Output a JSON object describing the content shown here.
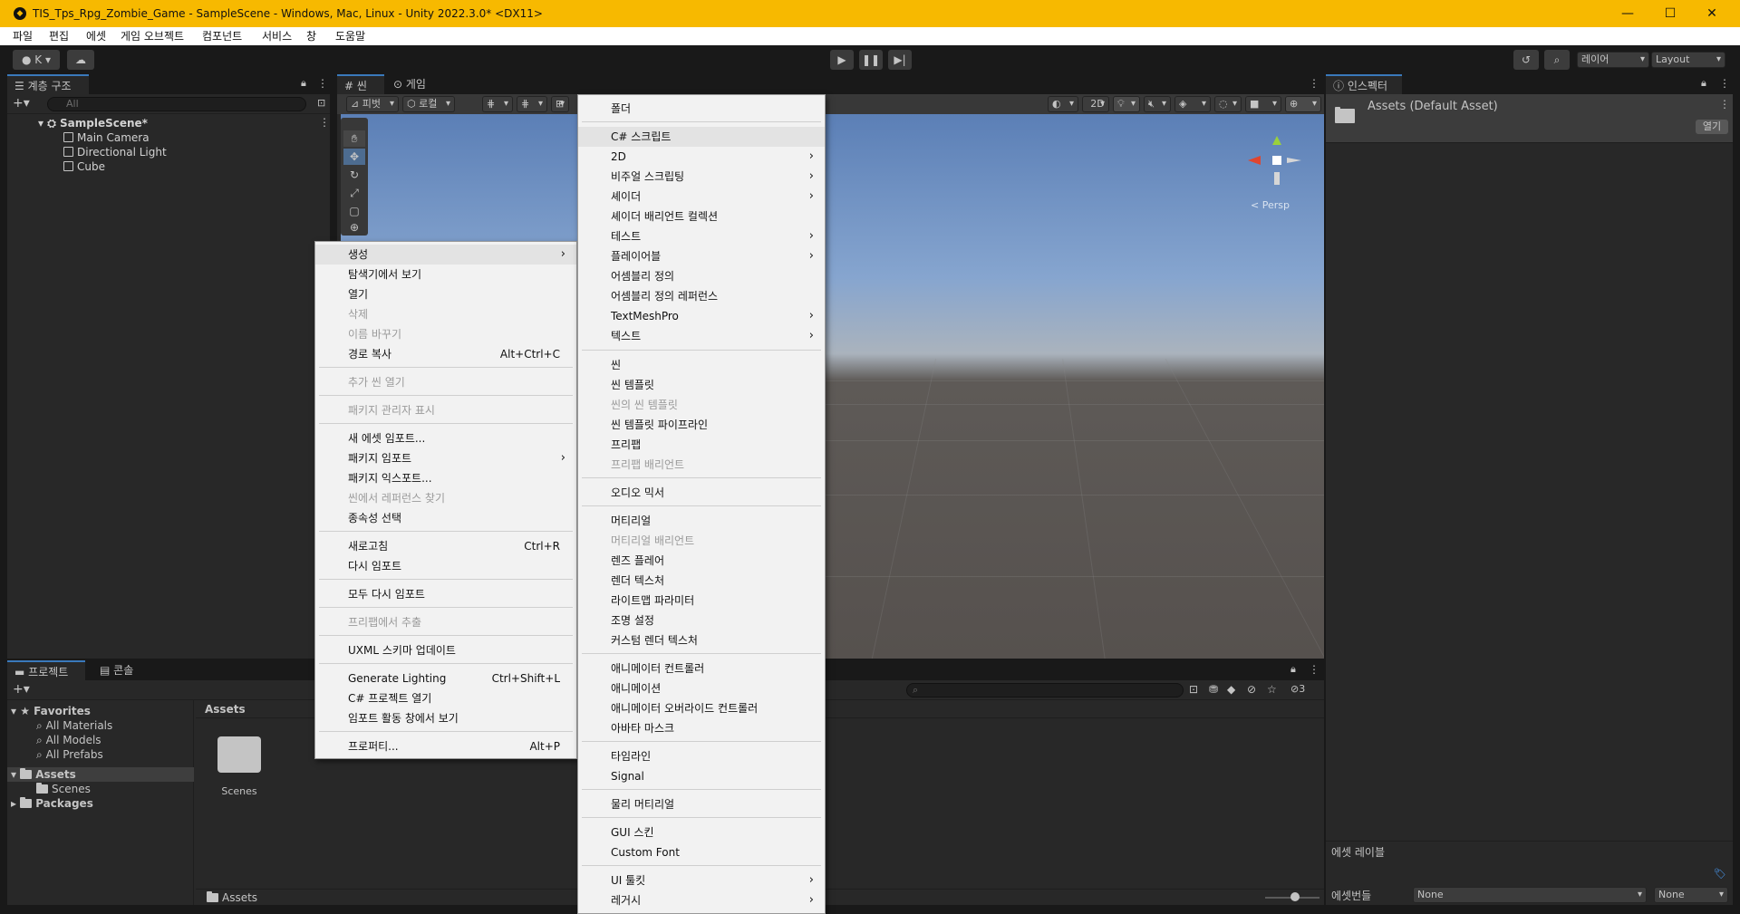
{
  "window": {
    "title": "TIS_Tps_Rpg_Zombie_Game - SampleScene - Windows, Mac, Linux - Unity 2022.3.0* <DX11>",
    "controls": [
      "—",
      "☐",
      "✕"
    ]
  },
  "menubar": [
    "파일",
    "편집",
    "에셋",
    "게임 오브젝트",
    "컴포넌트",
    "서비스",
    "창",
    "도움말"
  ],
  "toolbar": {
    "account": "K",
    "layers_label": "레이어",
    "layout_label": "Layout"
  },
  "hierarchy": {
    "tab": "계층 구조",
    "search_placeholder": "All",
    "scene": "SampleScene*",
    "objects": [
      "Main Camera",
      "Directional Light",
      "Cube"
    ]
  },
  "scene_tabs": [
    "씬",
    "게임"
  ],
  "scene_toolbar": {
    "pivot": "피벗",
    "local": "로컬",
    "mode2d": "2D",
    "persp": "< Persp"
  },
  "inspector": {
    "tab": "인스펙터",
    "asset_title": "Assets (Default Asset)",
    "open_button": "열기",
    "asset_labels": "에셋 레이블",
    "asset_bundle": "에셋번들",
    "bundle_value": "None",
    "variant_value": "None"
  },
  "project": {
    "tabs": [
      "프로젝트",
      "콘솔"
    ],
    "favorites": "Favorites",
    "favorite_items": [
      "All Materials",
      "All Models",
      "All Prefabs"
    ],
    "assets_root": "Assets",
    "assets_children": [
      "Scenes"
    ],
    "packages": "Packages",
    "breadcrumb": "Assets",
    "grid_items": [
      "Scenes"
    ],
    "footer_path": "Assets",
    "hidden_count": "3"
  },
  "context_menu": [
    {
      "label": "생성",
      "submenu": true
    },
    {
      "label": "탐색기에서 보기"
    },
    {
      "label": "열기"
    },
    {
      "label": "삭제",
      "disabled": true
    },
    {
      "label": "이름 바꾸기",
      "disabled": true
    },
    {
      "label": "경로 복사",
      "shortcut": "Alt+Ctrl+C"
    },
    {
      "label": "추가 씬 열기",
      "disabled": true
    },
    {
      "label": "패키지 관리자 표시",
      "disabled": true
    },
    {
      "label": "새 에셋 임포트..."
    },
    {
      "label": "패키지 임포트",
      "submenu": true
    },
    {
      "label": "패키지 익스포트..."
    },
    {
      "label": "씬에서 레퍼런스 찾기",
      "disabled": true
    },
    {
      "label": "종속성 선택"
    },
    {
      "label": "새로고침",
      "shortcut": "Ctrl+R"
    },
    {
      "label": "다시 임포트"
    },
    {
      "label": "모두 다시 임포트"
    },
    {
      "label": "프리팹에서 추출",
      "disabled": true
    },
    {
      "label": "UXML 스키마 업데이트"
    },
    {
      "label": "Generate Lighting",
      "shortcut": "Ctrl+Shift+L"
    },
    {
      "label": "C# 프로젝트 열기"
    },
    {
      "label": "임포트 활동 창에서 보기"
    },
    {
      "label": "프로퍼티...",
      "shortcut": "Alt+P"
    }
  ],
  "create_submenu": [
    {
      "label": "폴더"
    },
    {
      "label": "C# 스크립트"
    },
    {
      "label": "2D",
      "submenu": true
    },
    {
      "label": "비주얼 스크립팅",
      "submenu": true
    },
    {
      "label": "셰이더",
      "submenu": true
    },
    {
      "label": "셰이더 배리언트 컬렉션"
    },
    {
      "label": "테스트",
      "submenu": true
    },
    {
      "label": "플레이어블",
      "submenu": true
    },
    {
      "label": "어셈블리 정의"
    },
    {
      "label": "어셈블리 정의 레퍼런스"
    },
    {
      "label": "TextMeshPro",
      "submenu": true
    },
    {
      "label": "텍스트",
      "submenu": true
    },
    {
      "label": "씬"
    },
    {
      "label": "씬 템플릿"
    },
    {
      "label": "씬의 씬 템플릿",
      "disabled": true
    },
    {
      "label": "씬 템플릿 파이프라인"
    },
    {
      "label": "프리팹"
    },
    {
      "label": "프리팹 배리언트",
      "disabled": true
    },
    {
      "label": "오디오 믹서"
    },
    {
      "label": "머티리얼"
    },
    {
      "label": "머티리얼 배리언트",
      "disabled": true
    },
    {
      "label": "렌즈 플레어"
    },
    {
      "label": "렌더 텍스처"
    },
    {
      "label": "라이트맵 파라미터"
    },
    {
      "label": "조명 설정"
    },
    {
      "label": "커스텀 렌더 텍스처"
    },
    {
      "label": "애니메이터 컨트롤러"
    },
    {
      "label": "애니메이션"
    },
    {
      "label": "애니메이터 오버라이드 컨트롤러"
    },
    {
      "label": "아바타 마스크"
    },
    {
      "label": "타임라인"
    },
    {
      "label": "Signal"
    },
    {
      "label": "물리 머티리얼"
    },
    {
      "label": "GUI 스킨"
    },
    {
      "label": "Custom Font"
    },
    {
      "label": "UI 툴킷",
      "submenu": true
    },
    {
      "label": "레거시",
      "submenu": true
    }
  ]
}
